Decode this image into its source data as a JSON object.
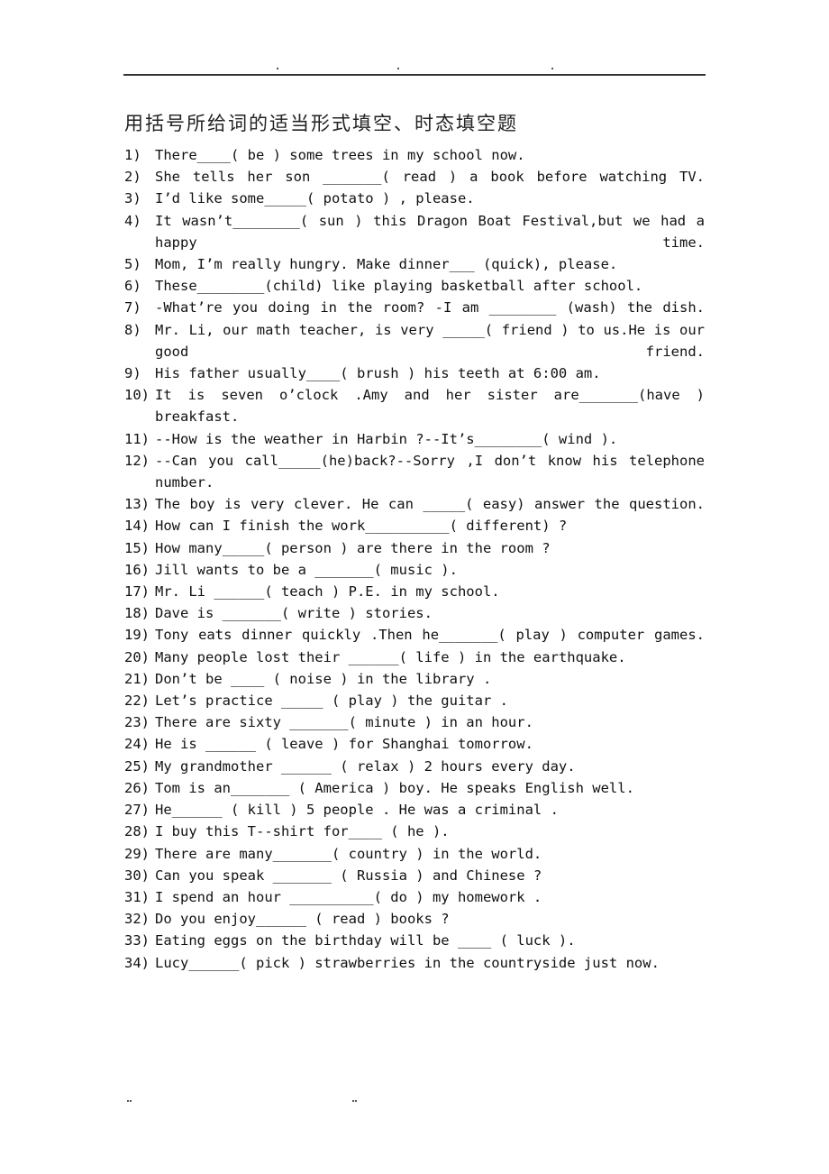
{
  "header": {
    "dots": 3
  },
  "title": "用括号所给词的适当形式填空、时态填空题",
  "items": [
    {
      "num": "1)",
      "text": "There____( be )  some  trees  in  my  school  now."
    },
    {
      "num": "2)",
      "text": "She  tells   her  son _______( read )  a  book  before   watching TV."
    },
    {
      "num": "3)",
      "text": "I’d  like  some_____( potato ) ,  please."
    },
    {
      "num": "4)",
      "text": "It wasn’t________( sun ) this Dragon Boat Festival,but we had a happy time."
    },
    {
      "num": "5)",
      "text": "Mom,  I’m  really  hungry.  Make dinner___ (quick),  please."
    },
    {
      "num": "6)",
      "text": "These________(child)  like  playing  basketball  after  school."
    },
    {
      "num": "7)",
      "text": "-What’re  you  doing  in  the  room?  -I am ________ (wash)  the dish."
    },
    {
      "num": "8)",
      "text": "Mr. Li, our math teacher, is very _____( friend ) to us.He is our good friend."
    },
    {
      "num": "9)",
      "text": "His  father  usually____( brush )  his  teeth  at  6:00  am."
    },
    {
      "num": "10)",
      "text": "It  is  seven  o’clock .Amy  and  her  sister  are_______(have ) breakfast."
    },
    {
      "num": "11)",
      "text": "--How  is  the  weather  in  Harbin ?--It’s________( wind )."
    },
    {
      "num": "12)",
      "text": "--Can you call_____(he)back?--Sorry ,I don’t know his telephone number."
    },
    {
      "num": "13)",
      "text": "The  boy  is  very  clever. He  can _____( easy) answer  the question."
    },
    {
      "num": "14)",
      "text": "How  can  I  finish  the  work__________( different) ?"
    },
    {
      "num": "15)",
      "text": "How  many_____( person )  are  there  in  the  room ?"
    },
    {
      "num": "16)",
      "text": "Jill  wants  to  be  a _______( music )."
    },
    {
      "num": "17)",
      "text": "Mr.  Li ______( teach )  P.E.  in  my  school."
    },
    {
      "num": "18)",
      "text": "Dave  is _______( write )  stories."
    },
    {
      "num": "19)",
      "text": "Tony  eats  dinner  quickly .Then  he_______( play )  computer games."
    },
    {
      "num": "20)",
      "text": "Many  people  lost  their ______( life )  in  the  earthquake."
    },
    {
      "num": "21)",
      "text": "Don’t  be ____ ( noise )  in  the  library ."
    },
    {
      "num": "22)",
      "text": "Let’s  practice _____ ( play )  the  guitar ."
    },
    {
      "num": "23)",
      "text": "There  are  sixty _______( minute )  in  an  hour."
    },
    {
      "num": "24)",
      "text": "He  is ______  ( leave )  for  Shanghai  tomorrow."
    },
    {
      "num": "25)",
      "text": "My  grandmother ______ ( relax )  2  hours  every  day."
    },
    {
      "num": "26)",
      "text": "Tom  is  an_______ ( America )  boy.  He  speaks  English  well."
    },
    {
      "num": "27)",
      "text": "He______ ( kill )  5  people .  He  was  a  criminal ."
    },
    {
      "num": "28)",
      "text": "I  buy  this  T--shirt  for____ ( he )."
    },
    {
      "num": "29)",
      "text": "There  are  many_______( country )  in  the  world."
    },
    {
      "num": "30)",
      "text": "Can  you  speak _______ ( Russia )  and  Chinese ?"
    },
    {
      "num": "31)",
      "text": "I  spend  an  hour __________( do )  my  homework ."
    },
    {
      "num": "32)",
      "text": "Do  you  enjoy______ ( read )  books ?"
    },
    {
      "num": "33)",
      "text": "Eating  eggs  on  the  birthday  will  be ____ ( luck )."
    },
    {
      "num": "34)",
      "text": "Lucy______( pick )  strawberries  in  the  countryside  just  now."
    }
  ],
  "footer": {
    "left_mark": "..",
    "right_mark": ".."
  }
}
